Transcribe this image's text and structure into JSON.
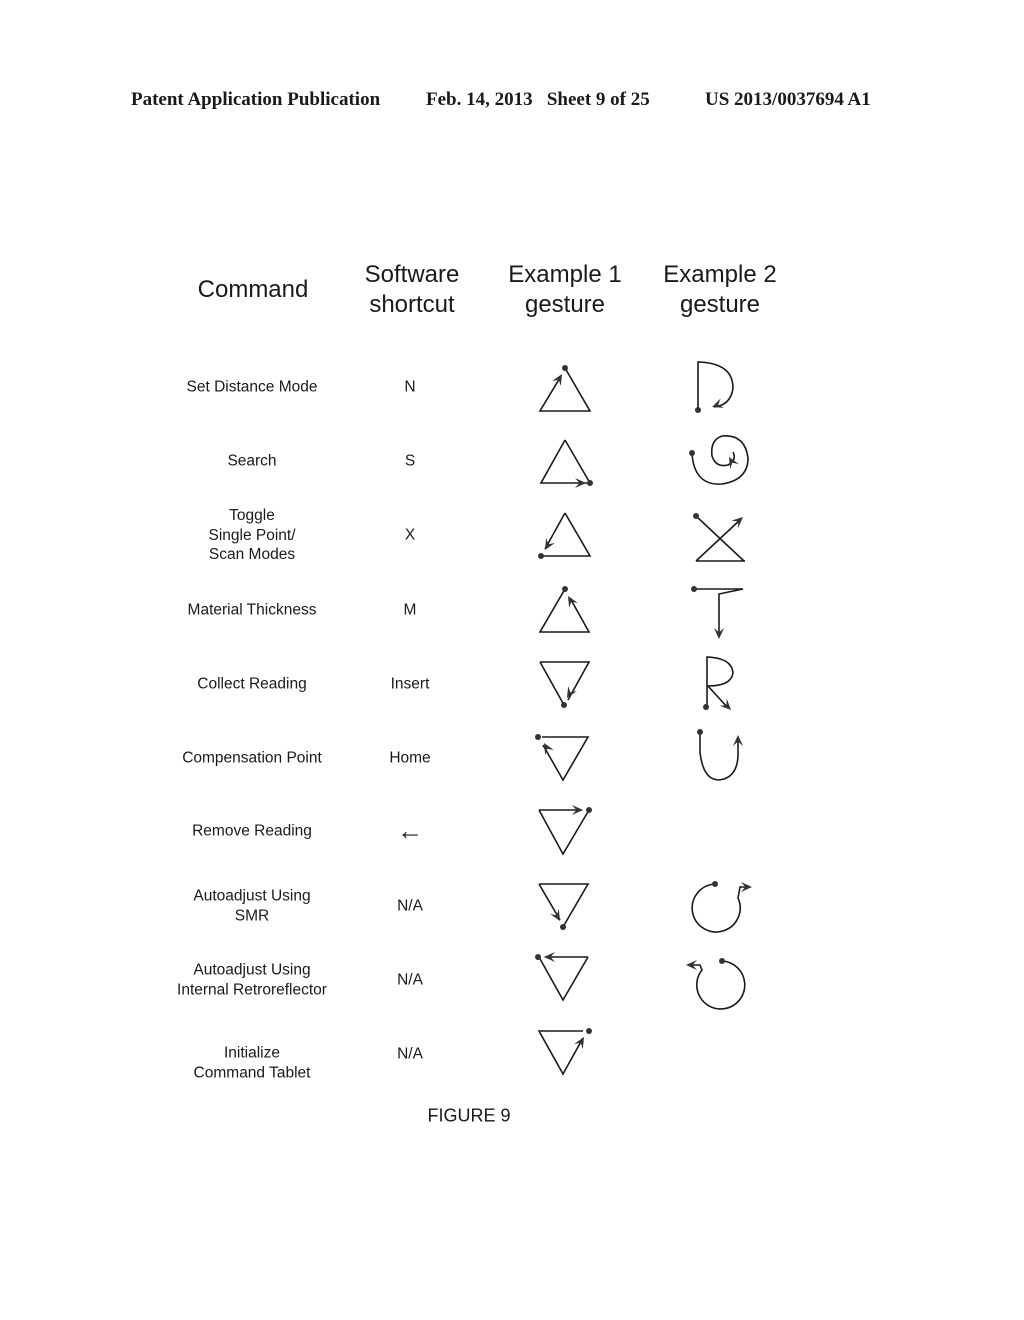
{
  "header": {
    "publication": "Patent Application Publication",
    "date_sheet": "Feb. 14, 2013   Sheet 9 of 25",
    "patent_number": "US 2013/0037694 A1"
  },
  "table": {
    "columns": [
      "Command",
      "Software\nshortcut",
      "Example 1\ngesture",
      "Example 2\ngesture"
    ],
    "rows": [
      {
        "command": "Set Distance Mode",
        "shortcut": "N",
        "gesture1": "triangle-up-start-top-arrow-left-side",
        "gesture2": "letter-D"
      },
      {
        "command": "Search",
        "shortcut": "S",
        "gesture1": "triangle-up-end-bottom-right-arrow-right",
        "gesture2": "spiral"
      },
      {
        "command": "Toggle\nSingle Point/\nScan Modes",
        "shortcut": "X",
        "gesture1": "triangle-up-end-bottom-left-arrow-down-left",
        "gesture2": "x-with-base"
      },
      {
        "command": "Material Thickness",
        "shortcut": "M",
        "gesture1": "triangle-up-start-top-arrow-right-side-up",
        "gesture2": "letter-T-arrow-down"
      },
      {
        "command": "Collect Reading",
        "shortcut": "Insert",
        "gesture1": "triangle-down-end-bottom-arrow-down-left",
        "gesture2": "letter-R"
      },
      {
        "command": "Compensation Point",
        "shortcut": "Home",
        "gesture1": "triangle-down-end-top-left-arrow-up-left",
        "gesture2": "letter-U-arrow-up"
      },
      {
        "command": "Remove Reading",
        "shortcut": "←",
        "gesture1": "triangle-down-end-top-right-arrow-right",
        "gesture2": ""
      },
      {
        "command": "Autoadjust Using\nSMR",
        "shortcut": "N/A",
        "gesture1": "triangle-down-end-bottom-arrow-down-right",
        "gesture2": "circle-clockwise-arrow-right"
      },
      {
        "command": "Autoadjust Using\nInternal Retroreflector",
        "shortcut": "N/A",
        "gesture1": "triangle-down-end-top-left-arrow-left",
        "gesture2": "circle-counterclockwise-arrow-left"
      },
      {
        "command": "Initialize\nCommand Tablet",
        "shortcut": "N/A",
        "gesture1": "triangle-down-end-top-right-arrow-up-right",
        "gesture2": ""
      }
    ]
  },
  "caption": "FIGURE 9"
}
